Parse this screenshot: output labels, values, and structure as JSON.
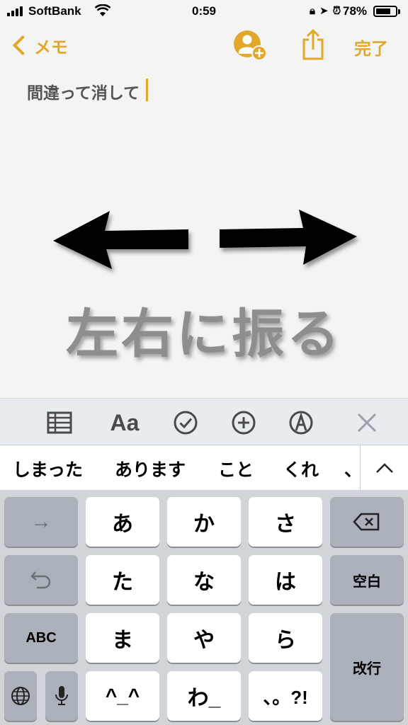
{
  "status_bar": {
    "carrier": "SoftBank",
    "time": "0:59",
    "battery_percent": "78%",
    "battery_level": 0.78,
    "icons": [
      "signal-icon",
      "wifi-icon",
      "orientation-lock-icon",
      "location-icon",
      "alarm-icon",
      "battery-icon"
    ]
  },
  "nav": {
    "back_label": "メモ",
    "done_label": "完了",
    "icons": [
      "add-collaborator-icon",
      "share-icon"
    ]
  },
  "note": {
    "text": "間違って消して"
  },
  "overlay": {
    "caption": "左右に振る"
  },
  "toolbar": {
    "icons": [
      "table-icon",
      "format-text-icon",
      "checklist-icon",
      "add-icon",
      "markup-icon",
      "close-icon"
    ],
    "format_label": "Aa"
  },
  "suggestions": [
    "しまった",
    "あります",
    "こと",
    "くれ",
    "、"
  ],
  "keyboard": {
    "accent": "#e2a82b",
    "rows": [
      [
        "→",
        "あ",
        "か",
        "さ",
        "⌫"
      ],
      [
        "↺",
        "た",
        "な",
        "は",
        "空白"
      ],
      [
        "ABC",
        "ま",
        "や",
        "ら",
        "改行"
      ],
      [
        "🌐",
        "🎤",
        "^^",
        "わ_",
        "、。?!"
      ]
    ],
    "next_label": "→",
    "undo_label": "↺",
    "abc_label": "ABC",
    "space_label": "空白",
    "return_label": "改行",
    "kana": {
      "a": "あ",
      "ka": "か",
      "sa": "さ",
      "ta": "た",
      "na": "な",
      "ha": "は",
      "ma": "ま",
      "ya": "や",
      "ra": "ら",
      "emoticon": "^_^",
      "wa": "わ_",
      "punct": "、。?!"
    }
  }
}
